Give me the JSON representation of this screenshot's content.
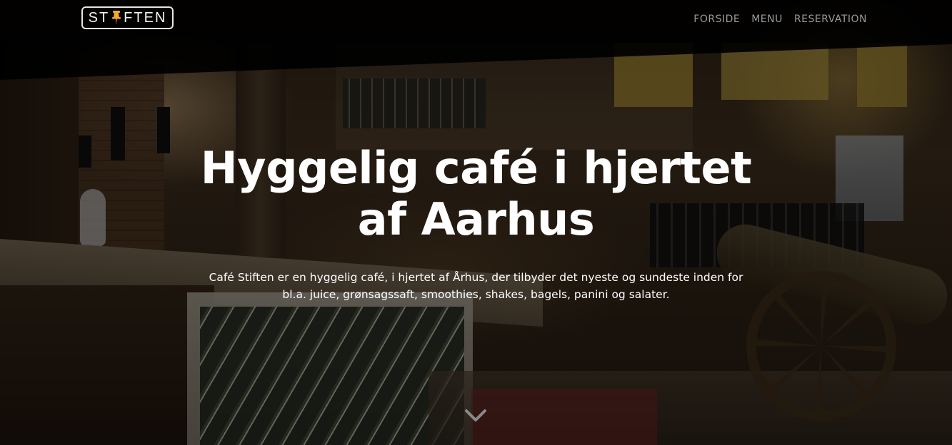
{
  "navbar": {
    "brand": {
      "text_before": "ST",
      "text_after": "FTEN",
      "icon": "pushpin-icon",
      "icon_color": "#f0a830"
    },
    "links": [
      {
        "label": "FORSIDE"
      },
      {
        "label": "MENU"
      },
      {
        "label": "RESERVATION"
      }
    ]
  },
  "hero": {
    "title": "Hyggelig café i hjertet af Aarhus",
    "subtitle": "Café Stiften er en hyggelig café, i hjertet af Århus, der tilbyder det nyeste og sundeste inden for bl.a. juice, grønsagssaft, smoothies, shakes, bagels, panini og salater.",
    "scroll_icon": "chevron-down-icon"
  },
  "colors": {
    "navbar_bg": "#000000",
    "nav_link": "#9a9a9a",
    "hero_text": "#ffffff",
    "accent": "#f0a830"
  }
}
